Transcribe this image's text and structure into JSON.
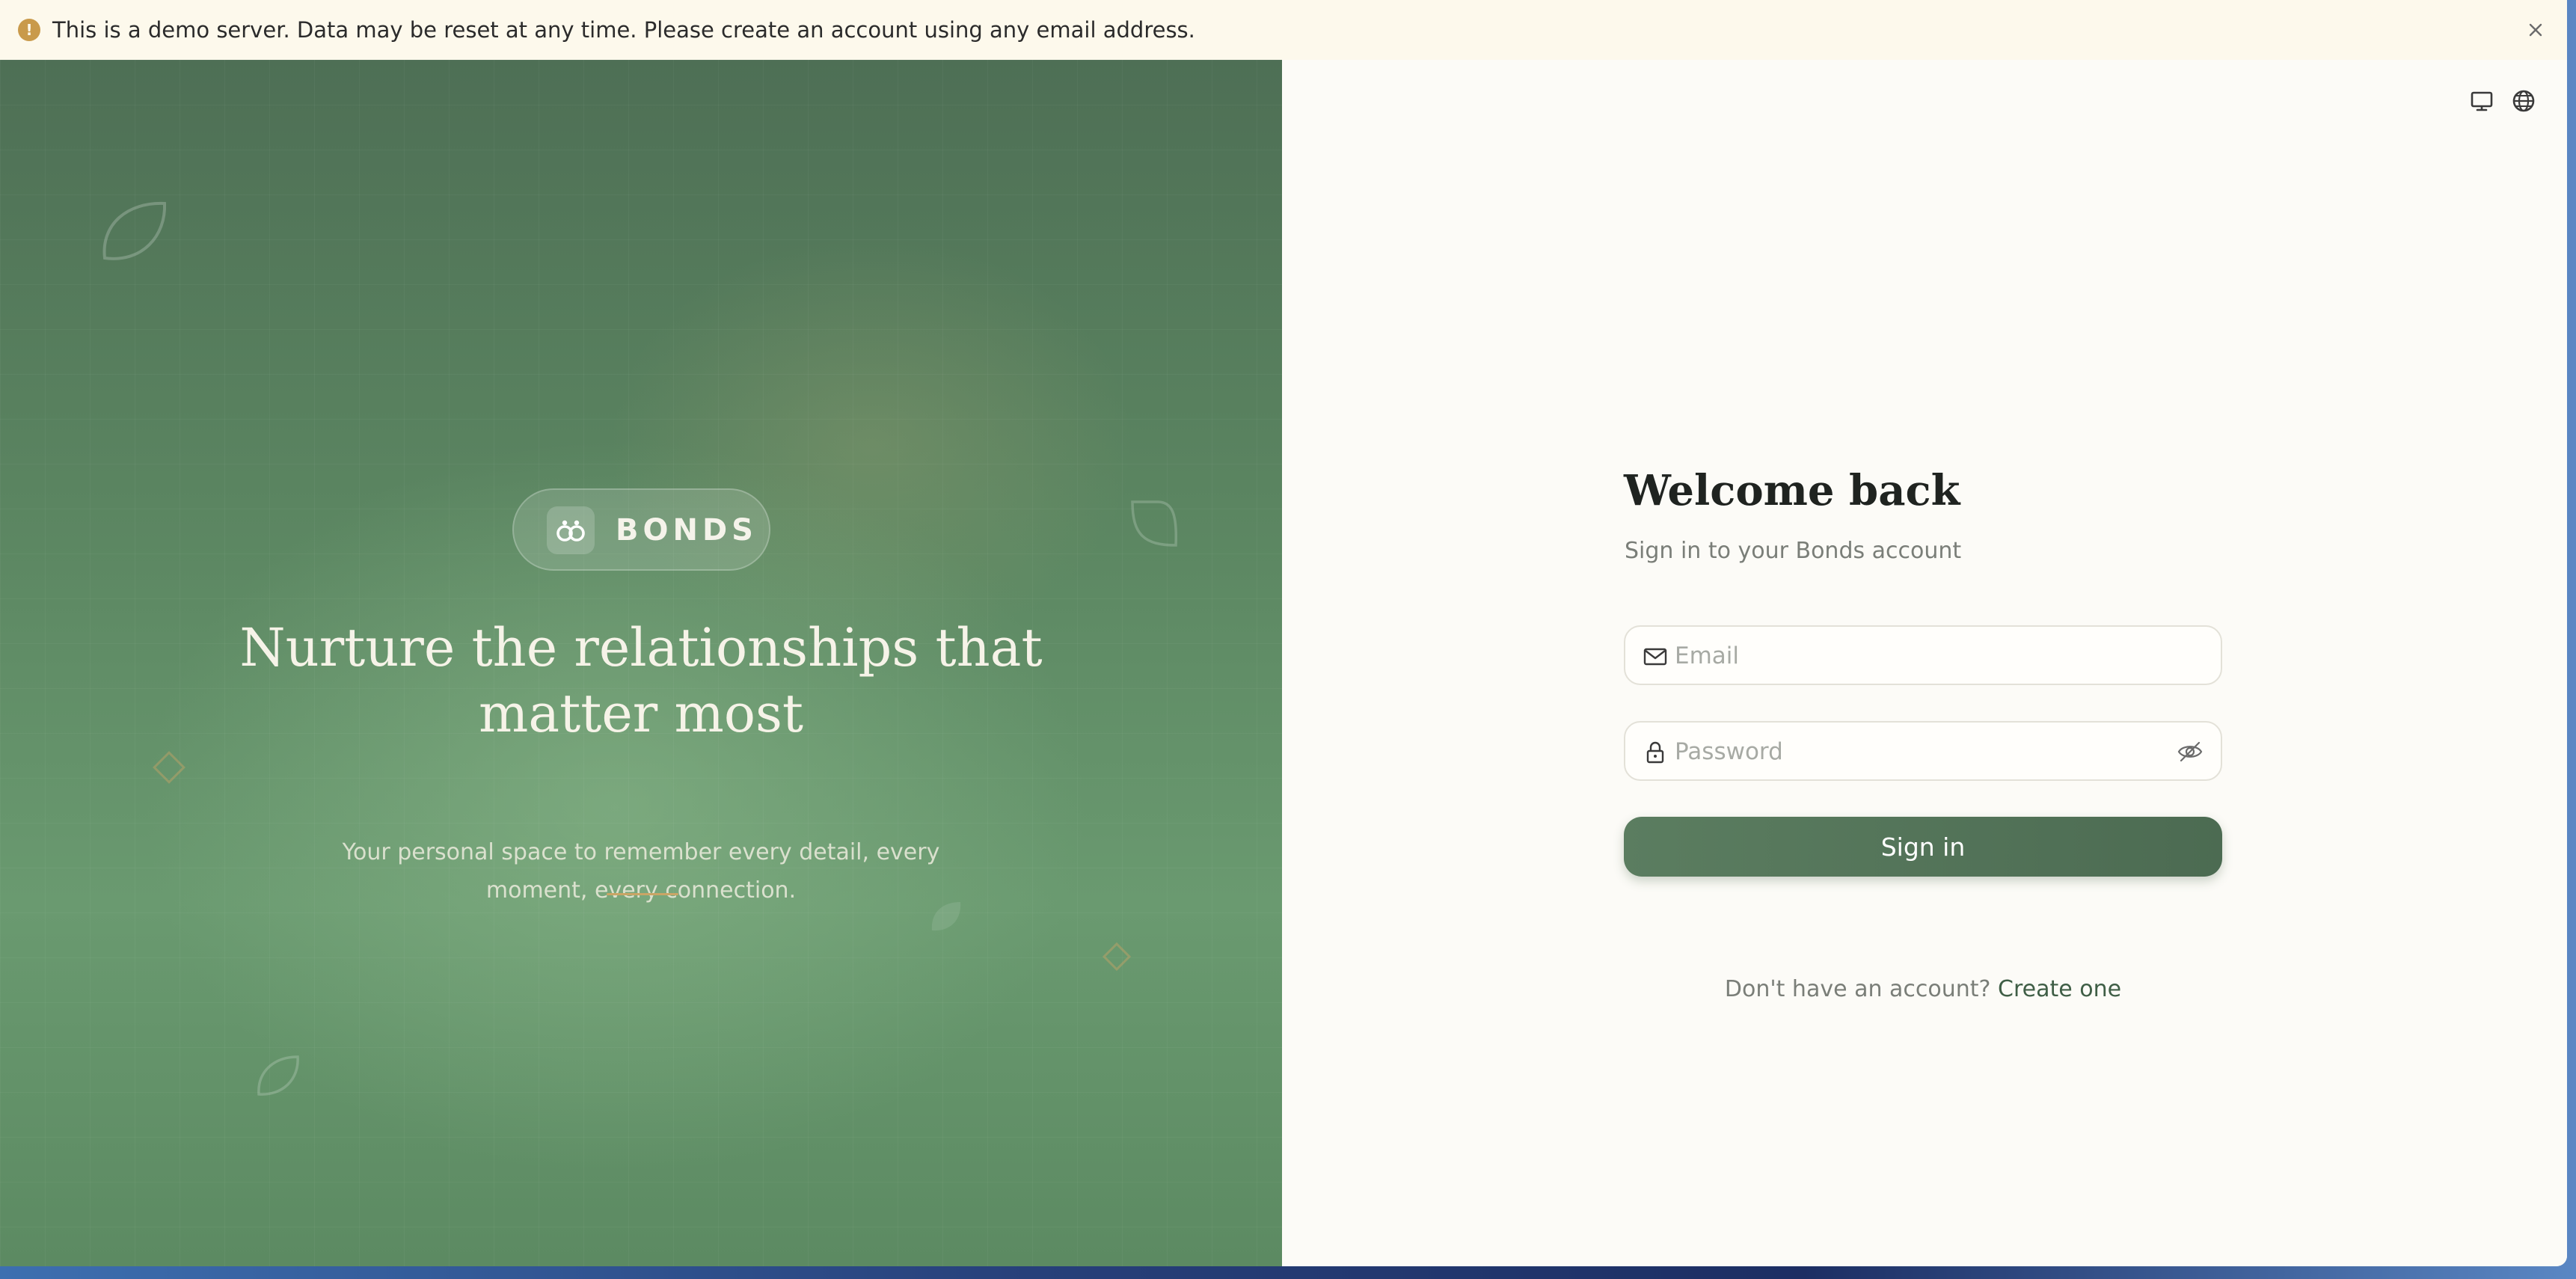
{
  "banner": {
    "icon": "exclamation-icon",
    "alert_glyph": "!",
    "text": "This is a demo server. Data may be reset at any time. Please create an account using any email address.",
    "close_icon": "close-icon"
  },
  "hero": {
    "brand_name": "BONDS",
    "brand_logo_icon": "infinity-link-icon",
    "title": "Nurture the relationships that matter most",
    "subtitle": "Your personal space to remember every detail, every moment, every connection.",
    "colors": {
      "background_top": "#4e6f55",
      "background_mid": "#6a9a70",
      "accent_divider": "#c9a565"
    }
  },
  "auth": {
    "top_icons": [
      "monitor-icon",
      "globe-icon"
    ],
    "title": "Welcome back",
    "subtitle": "Sign in to your Bonds account",
    "email": {
      "placeholder": "Email",
      "value": "",
      "icon": "mail-icon"
    },
    "password": {
      "placeholder": "Password",
      "value": "",
      "icon": "lock-icon",
      "toggle_icon": "eye-off-icon"
    },
    "signin_label": "Sign in",
    "signup_prompt": "Don't have an account?",
    "signup_link": "Create one",
    "colors": {
      "button": "#557558",
      "link": "#3f5e46",
      "muted_text": "#7a7e78"
    }
  }
}
